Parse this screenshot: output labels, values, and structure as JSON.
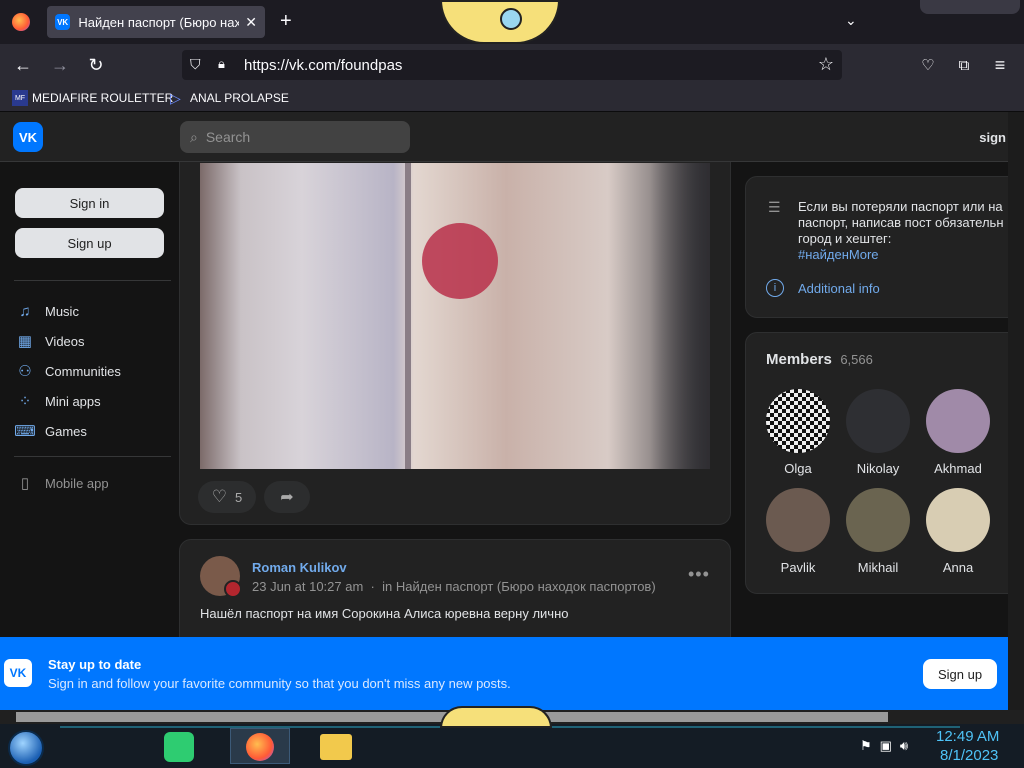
{
  "browser": {
    "tab_title": "Найден паспорт (Бюро находо",
    "tab_icon": "vk-favicon",
    "url": "https://vk.com/foundpas",
    "bookmarks": [
      {
        "label": "MEDIAFIRE ROULETTER",
        "icon": "mf-icon"
      },
      {
        "label": "ANAL PROLAPSE",
        "icon": "triangle-icon"
      }
    ]
  },
  "vk": {
    "logo": "VK",
    "search_placeholder": "Search",
    "header_signin": "sign",
    "sign_in": "Sign in",
    "sign_up": "Sign up",
    "menu": [
      {
        "label": "Music",
        "icon": "music-icon"
      },
      {
        "label": "Videos",
        "icon": "video-icon"
      },
      {
        "label": "Communities",
        "icon": "communities-icon"
      },
      {
        "label": "Mini apps",
        "icon": "mini-apps-icon"
      },
      {
        "label": "Games",
        "icon": "games-icon"
      }
    ],
    "mobile_app": "Mobile app"
  },
  "post1": {
    "likes": "5"
  },
  "post2": {
    "author": "Roman Kulikov",
    "date": "23 Jun at 10:27 am",
    "separator": "·",
    "in_prefix": "in",
    "community": "Найден паспорт (Бюро находок паспортов)",
    "text": "Нашёл паспорт на имя Сорокина Алиса юревна верну лично"
  },
  "info": {
    "text_lines": [
      "Если вы потеряли паспорт или на",
      "паспорт, написав пост обязательн",
      "город и хештег:"
    ],
    "hashtag": "#найденMore",
    "additional": "Additional info"
  },
  "members": {
    "title": "Members",
    "count": "6,566",
    "items": [
      {
        "name": "Olga",
        "color": "#e9e9e9"
      },
      {
        "name": "Nikolay",
        "color": "#2e2f33"
      },
      {
        "name": "Akhmad",
        "color": "#a08aa8"
      },
      {
        "name": "Pavlik",
        "color": "#6b5a50"
      },
      {
        "name": "Mikhail",
        "color": "#6a6450"
      },
      {
        "name": "Anna",
        "color": "#d8cdb3"
      }
    ]
  },
  "banner": {
    "title": "Stay up to date",
    "subtitle": "Sign in and follow your favorite community so that you don't miss any new posts.",
    "button": "Sign up"
  },
  "taskbar": {
    "time": "12:49 AM",
    "date": "8/1/2023"
  },
  "colors": {
    "vk_blue": "#0077ff",
    "link": "#71aaeb",
    "card_bg": "#222222",
    "page_bg": "#141414"
  }
}
